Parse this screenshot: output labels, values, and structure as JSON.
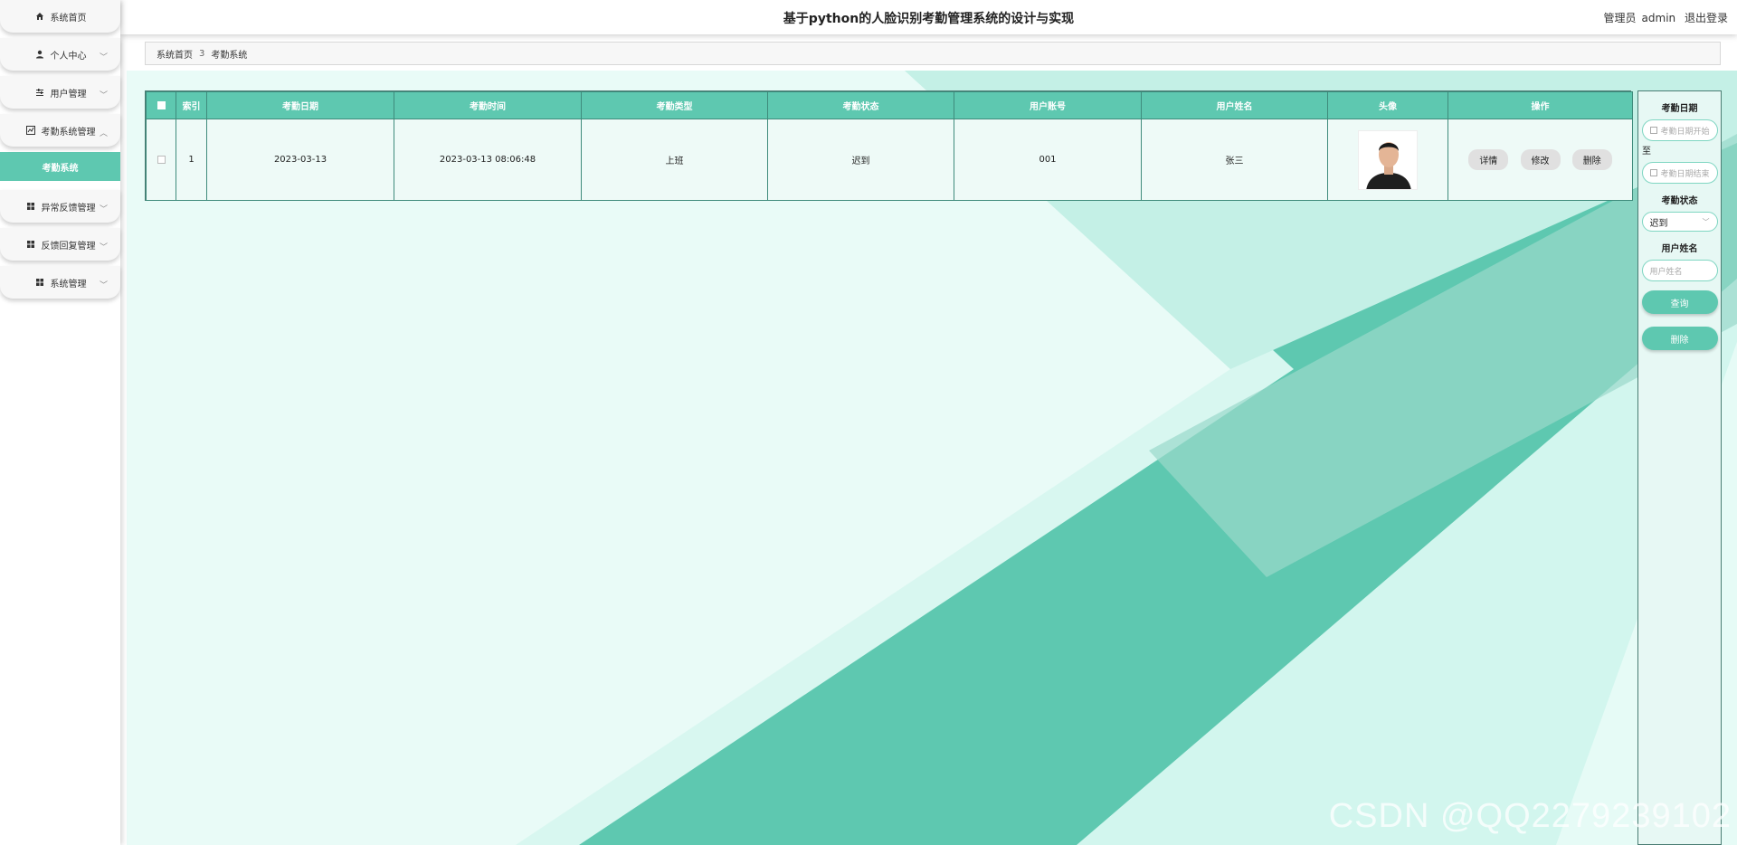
{
  "header": {
    "title": "基于python的人脸识别考勤管理系统的设计与实现",
    "role": "管理员",
    "username": "admin",
    "logout": "退出登录"
  },
  "sidebar": {
    "items": [
      {
        "label": "系统首页",
        "icon": "home-icon"
      },
      {
        "label": "个人中心",
        "icon": "user-icon"
      },
      {
        "label": "用户管理",
        "icon": "sliders-icon"
      },
      {
        "label": "考勤系统管理",
        "icon": "chart-icon"
      },
      {
        "label": "考勤系统",
        "icon": ""
      },
      {
        "label": "异常反馈管理",
        "icon": "grid-icon"
      },
      {
        "label": "反馈回复管理",
        "icon": "grid-icon"
      },
      {
        "label": "系统管理",
        "icon": "grid-icon"
      }
    ]
  },
  "breadcrumb": {
    "home": "系统首页",
    "separator": "3",
    "current": "考勤系统"
  },
  "table": {
    "headers": [
      "索引",
      "考勤日期",
      "考勤时间",
      "考勤类型",
      "考勤状态",
      "用户账号",
      "用户姓名",
      "头像",
      "操作"
    ],
    "rows": [
      {
        "index": "1",
        "date": "2023-03-13",
        "time": "2023-03-13 08:06:48",
        "type": "上班",
        "status": "迟到",
        "account": "001",
        "name": "张三"
      }
    ],
    "actions": {
      "detail": "详情",
      "edit": "修改",
      "delete": "删除"
    }
  },
  "search": {
    "date_label": "考勤日期",
    "date_start_placeholder": "考勤日期开始",
    "to": "至",
    "date_end_placeholder": "考勤日期结束",
    "status_label": "考勤状态",
    "status_value": "迟到",
    "name_label": "用户姓名",
    "name_placeholder": "用户姓名",
    "query_button": "查询",
    "delete_button": "删除"
  },
  "watermark": "CSDN @QQ2279239102",
  "colors": {
    "accent": "#5ec8b0",
    "background": "#c8f3ea"
  }
}
